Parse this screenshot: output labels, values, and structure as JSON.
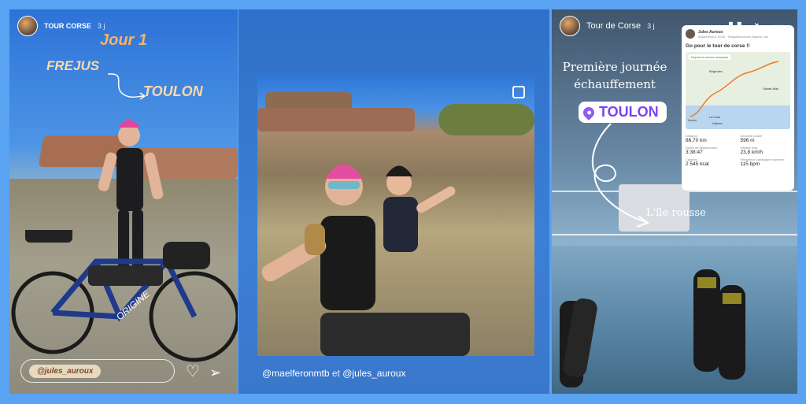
{
  "story1": {
    "username": "TOUR CORSE",
    "age": "3 j",
    "title": "Jour 1",
    "from": "FREJUS",
    "to": "TOULON",
    "mention": "@jules_auroux"
  },
  "story2": {
    "caption_user1": "@maelferonmtb",
    "caption_and": "et",
    "caption_user2": "@jules_auroux"
  },
  "story3": {
    "username": "Tour de Corse",
    "age": "3 j",
    "line1": "Première journée",
    "line2": "échauffement",
    "location": "TOULON",
    "ile": "L'île rousse",
    "activity": {
      "athlete": "Jules Auroux",
      "subtitle": "Aujourd'hui à 10:52 · Roquebrune-sur-Argens, Var",
      "title": "Go pour le tour de corse !!",
      "map_label": "Départ et arrivée masqués",
      "places": [
        "Brignoles",
        "Sainte-Max",
        "Toulon",
        "Hyères",
        "La Crau"
      ],
      "stats": [
        {
          "label": "Distance",
          "value": "86,70 km"
        },
        {
          "label": "Dénivelé positif",
          "value": "596 m"
        },
        {
          "label": "Durée de déplacement",
          "value": "3:38:47"
        },
        {
          "label": "Vitesse moy.",
          "value": "23,8 km/h"
        },
        {
          "label": "Calories",
          "value": "2 545 kcal"
        },
        {
          "label": "Fréquence cardiaque moyenne",
          "value": "115 bpm"
        }
      ]
    }
  },
  "colors": {
    "background": "#5aa2f2",
    "location_accent": "#7a44f0",
    "title_orange": "#f3b467"
  }
}
